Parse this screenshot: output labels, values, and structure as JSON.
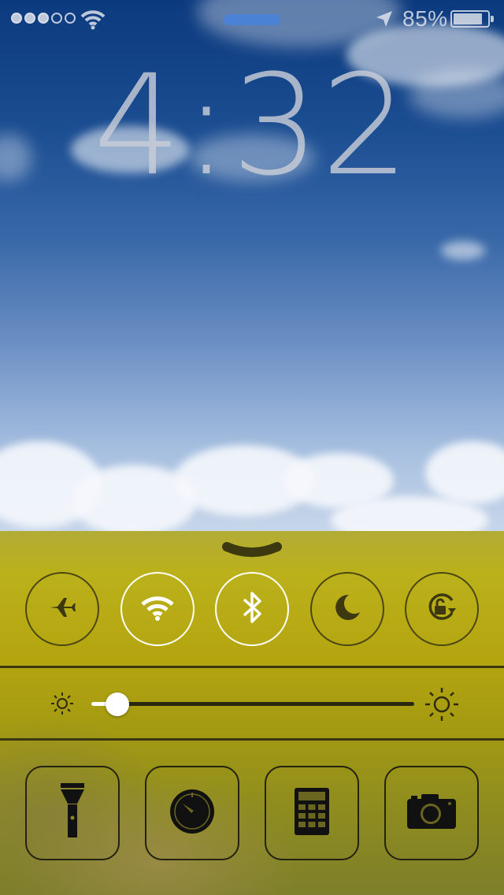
{
  "status_bar": {
    "signal_bars_filled": 3,
    "signal_bars_total": 5,
    "battery_percent": "85%",
    "battery_level": 0.85,
    "icons": [
      "wifi-icon",
      "location-arrow-icon",
      "battery-icon"
    ]
  },
  "lock_screen": {
    "time": "4:32"
  },
  "control_center": {
    "toggles": [
      {
        "name": "airplane-mode",
        "icon": "airplane-icon",
        "on": false
      },
      {
        "name": "wifi",
        "icon": "wifi-icon",
        "on": true
      },
      {
        "name": "bluetooth",
        "icon": "bluetooth-icon",
        "on": true
      },
      {
        "name": "do-not-disturb",
        "icon": "moon-icon",
        "on": false
      },
      {
        "name": "rotation-lock",
        "icon": "rotation-lock-icon",
        "on": false
      }
    ],
    "brightness_level": 0.08,
    "shortcuts": [
      {
        "name": "flashlight",
        "icon": "flashlight-icon"
      },
      {
        "name": "timer",
        "icon": "timer-icon"
      },
      {
        "name": "calculator",
        "icon": "calculator-icon"
      },
      {
        "name": "camera",
        "icon": "camera-icon"
      }
    ]
  },
  "colors": {
    "toggle_on_border": "#ffffff",
    "toggle_off_border": "#4b4614",
    "panel_yellow": "#bbb11a",
    "sky_blue": "#1c4e92"
  }
}
